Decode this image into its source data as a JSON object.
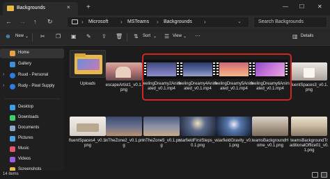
{
  "window": {
    "tab_title": "Backgrounds",
    "tab_close": "×",
    "tab_add": "+",
    "minimize": "—",
    "maximize": "☐",
    "close": "✕"
  },
  "address": {
    "crumbs": [
      "Microsoft",
      "MSTeams",
      "Backgrounds"
    ],
    "separator": "›",
    "search_placeholder": "Search Backgrounds"
  },
  "commands": {
    "new": "New",
    "sort": "Sort",
    "view": "View",
    "more": "···",
    "details": "Details"
  },
  "sidebar": {
    "items": [
      {
        "label": "Home",
        "icon": "home-icon"
      },
      {
        "label": "Gallery",
        "icon": "gallery-icon"
      },
      {
        "label": "Ruud - Personal",
        "icon": "cloud-icon"
      },
      {
        "label": "Rudy - Pixel Supply",
        "icon": "cloud-icon"
      },
      {
        "label": "Desktop",
        "icon": "desktop-icon"
      },
      {
        "label": "Downloads",
        "icon": "downloads-icon"
      },
      {
        "label": "Documents",
        "icon": "documents-icon"
      },
      {
        "label": "Pictures",
        "icon": "pictures-icon"
      },
      {
        "label": "Music",
        "icon": "music-icon"
      },
      {
        "label": "Videos",
        "icon": "videos-icon"
      },
      {
        "label": "Screenshots",
        "icon": "folder-icon"
      }
    ]
  },
  "files": [
    {
      "name": "Uploads",
      "kind": "folder"
    },
    {
      "name": "escapeArtist1_v0.1.png",
      "kind": "image"
    },
    {
      "name": "feelingDreamy2Animated_v0.1.mp4",
      "kind": "video"
    },
    {
      "name": "feelingDreamy4Animated_v0.1.mp4",
      "kind": "video"
    },
    {
      "name": "feelingDreamy5Animated_v0.1.mp4",
      "kind": "video"
    },
    {
      "name": "feelingDreamy6Animated_v0.1.mp4",
      "kind": "video"
    },
    {
      "name": "fluentSpaces3_v0.1.png",
      "kind": "image"
    },
    {
      "name": "fluentSpaces4_v0.1.png",
      "kind": "image"
    },
    {
      "name": "inTheZone2_v0.1.png",
      "kind": "image"
    },
    {
      "name": "inTheZone5_v0.1.png",
      "kind": "image"
    },
    {
      "name": "starfieldFirstSteps_v0.1.png",
      "kind": "image"
    },
    {
      "name": "starfieldGravity_v0.1.png",
      "kind": "image"
    },
    {
      "name": "teamsBackgroundHome_v0.1.png",
      "kind": "image"
    },
    {
      "name": "teamsBackgroundTraditionalOffice01_v0.1.png",
      "kind": "image"
    }
  ],
  "status": {
    "count": "14 items"
  }
}
